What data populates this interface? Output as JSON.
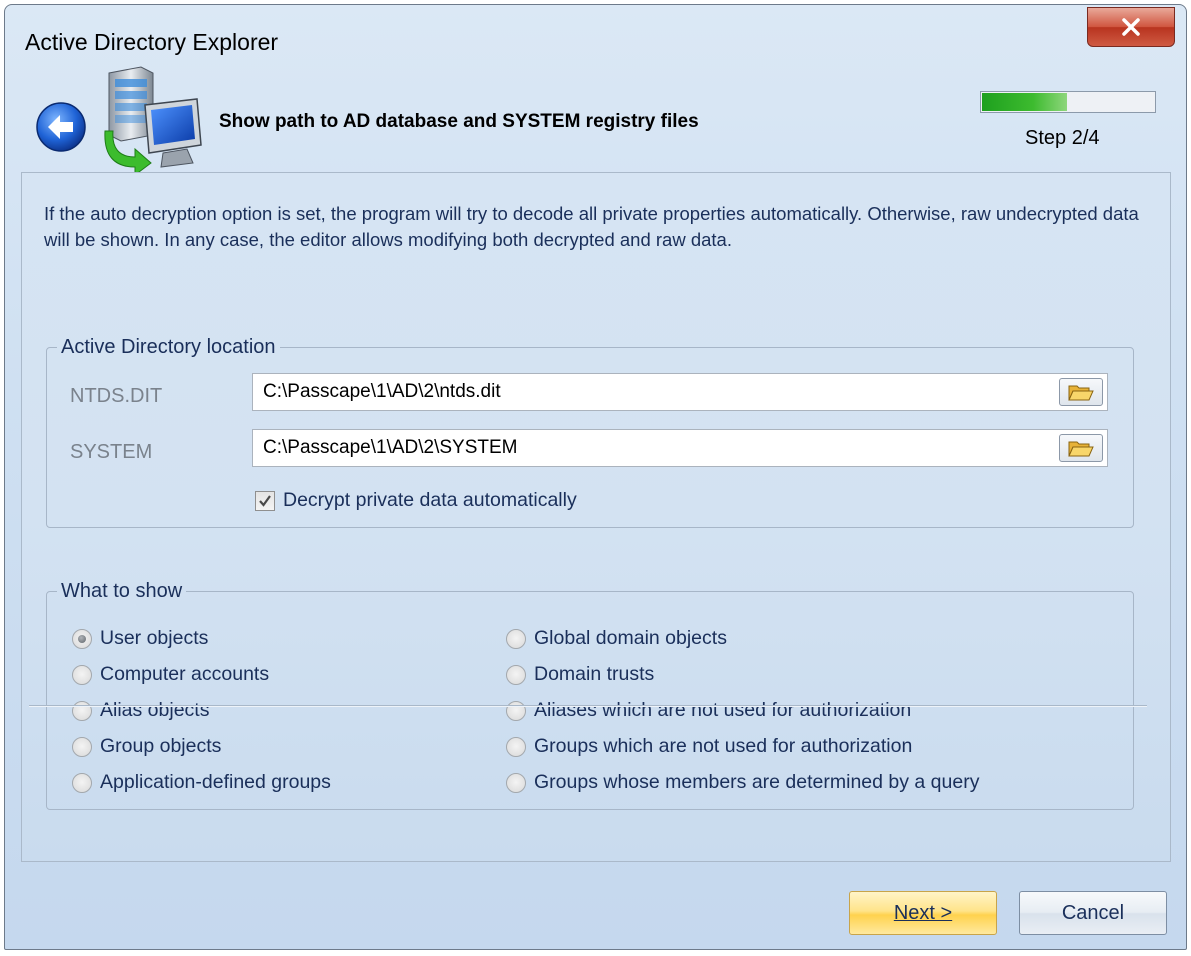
{
  "window": {
    "title": "Active Directory Explorer",
    "close_label": "X"
  },
  "header": {
    "title": "Show path to AD database and SYSTEM registry files",
    "step": "Step 2/4",
    "progress": 0.5
  },
  "description": "If the auto decryption option is set, the program will try to decode all private properties automatically. Otherwise, raw undecrypted data will be shown.  In any case, the editor allows modifying both decrypted and raw data.",
  "location_group": {
    "legend": "Active Directory location",
    "ntds_label": "NTDS.DIT",
    "ntds_value": "C:\\Passcape\\1\\AD\\2\\ntds.dit",
    "system_label": "SYSTEM",
    "system_value": "C:\\Passcape\\1\\AD\\2\\SYSTEM",
    "decrypt_label": "Decrypt private data automatically",
    "decrypt_checked": true
  },
  "show_group": {
    "legend": "What to show",
    "left": [
      {
        "label": "User objects",
        "checked": true
      },
      {
        "label": "Computer accounts",
        "checked": false
      },
      {
        "label": "Alias objects",
        "checked": false
      },
      {
        "label": "Group objects",
        "checked": false
      },
      {
        "label": "Application-defined groups",
        "checked": false
      }
    ],
    "right": [
      {
        "label": "Global domain objects",
        "checked": false
      },
      {
        "label": "Domain trusts",
        "checked": false
      },
      {
        "label": "Aliases which are not used for authorization",
        "checked": false
      },
      {
        "label": "Groups which are not used for authorization",
        "checked": false
      },
      {
        "label": "Groups whose members are determined by a query",
        "checked": false
      }
    ]
  },
  "buttons": {
    "next_label": "Next >",
    "cancel_label": "Cancel"
  },
  "colors": {
    "progress_fill": "#2fb22a",
    "close_button": "#c8452f",
    "next_button": "#ffd24e"
  },
  "icons": {
    "back": "back-arrow-icon",
    "wizard": "server-to-computer-icon",
    "folder": "open-folder-icon"
  }
}
